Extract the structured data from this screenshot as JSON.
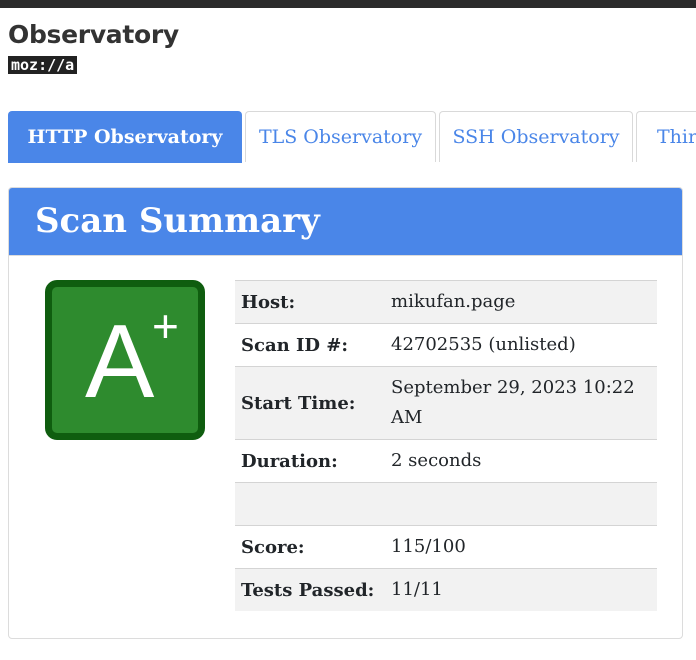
{
  "brand": {
    "title": "Observatory",
    "logo_text": "moz://a"
  },
  "tabs": [
    {
      "label": "HTTP Observatory",
      "active": true
    },
    {
      "label": "TLS Observatory",
      "active": false
    },
    {
      "label": "SSH Observatory",
      "active": false
    },
    {
      "label": "Third-party Tests",
      "active": false
    }
  ],
  "scan_summary": {
    "title": "Scan Summary",
    "grade": {
      "letter": "A",
      "modifier": "+"
    },
    "rows": [
      {
        "label": "Host:",
        "value": "mikufan.page"
      },
      {
        "label": "Scan ID #:",
        "value": "42702535 (unlisted)"
      },
      {
        "label": "Start Time:",
        "value": "September 29, 2023 10:22 AM"
      },
      {
        "label": "Duration:",
        "value": "2 seconds"
      },
      {
        "label": "",
        "value": ""
      },
      {
        "label": "Score:",
        "value": "115/100"
      },
      {
        "label": "Tests Passed:",
        "value": "11/11"
      }
    ]
  },
  "colors": {
    "accent": "#4a86e8",
    "grade_bg": "#2e8b2e",
    "grade_border": "#0f5d0f",
    "topbar": "#2b2b2b"
  }
}
